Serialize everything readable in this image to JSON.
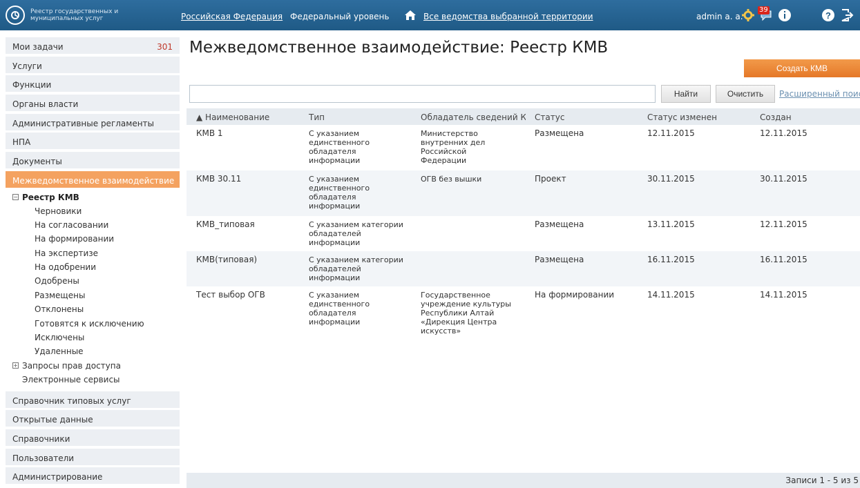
{
  "header": {
    "logo_text": "Реестр государственных и муниципальных услуг",
    "territory": "Российская Федерация",
    "level": "Федеральный уровень",
    "departments": "Все ведомства выбранной территории",
    "user": "admin a. a.",
    "notifications_count": "39"
  },
  "sidebar": {
    "items_top": [
      {
        "label": "Мои задачи",
        "count": "301"
      },
      {
        "label": "Услуги"
      },
      {
        "label": "Функции"
      },
      {
        "label": "Органы власти"
      },
      {
        "label": "Административные регламенты"
      },
      {
        "label": "НПА"
      },
      {
        "label": "Документы"
      },
      {
        "label": "Межведомственное взаимодействие"
      }
    ],
    "registry_title": "Реестр КМВ",
    "registry_children": [
      "Черновики",
      "На согласовании",
      "На формировании",
      "На экспертизе",
      "На одобрении",
      "Одобрены",
      "Размещены",
      "Отклонены",
      "Готовятся к исключению",
      "Исключены",
      "Удаленные"
    ],
    "access_requests": "Запросы прав доступа",
    "e_services": "Электронные сервисы",
    "items_bottom": [
      {
        "label": "Справочник типовых услуг"
      },
      {
        "label": "Открытые данные"
      },
      {
        "label": "Справочники"
      },
      {
        "label": "Пользователи"
      },
      {
        "label": "Администрирование"
      }
    ]
  },
  "main": {
    "title": "Межведомственное взаимодействие: Реестр КМВ",
    "create_button": "Создать КМВ",
    "search_placeholder": "",
    "find_button": "Найти",
    "clear_button": "Очистить",
    "advanced_search": "Расширенный поиск"
  },
  "table": {
    "columns": [
      "▲ Наименование",
      "Тип",
      "Обладатель сведений КМВ",
      "Статус",
      "Статус изменен",
      "Создан"
    ],
    "rows": [
      {
        "name": "КМВ 1",
        "type": "С указанием единственного обладателя информации",
        "owner": "Министерство внутренних дел Российской Федерации",
        "status": "Размещена",
        "changed": "12.11.2015",
        "created": "12.11.2015"
      },
      {
        "name": "КМВ 30.11",
        "type": "С указанием единственного обладателя информации",
        "owner": "ОГВ без вышки",
        "status": "Проект",
        "changed": "30.11.2015",
        "created": "30.11.2015"
      },
      {
        "name": "КМВ_типовая",
        "type": "С указанием категории обладателей информации",
        "owner": "",
        "status": "Размещена",
        "changed": "13.11.2015",
        "created": "12.11.2015"
      },
      {
        "name": "КМВ(типовая)",
        "type": "С указанием категории обладателей информации",
        "owner": "",
        "status": "Размещена",
        "changed": "16.11.2015",
        "created": "16.11.2015"
      },
      {
        "name": "Тест выбор ОГВ",
        "type": "С указанием единственного обладателя информации",
        "owner": "Государственное учреждение культуры Республики Алтай «Дирекция Центра искусств»",
        "status": "На формировании",
        "changed": "14.11.2015",
        "created": "14.11.2015"
      }
    ],
    "footer": "Записи 1 - 5 из 5"
  }
}
